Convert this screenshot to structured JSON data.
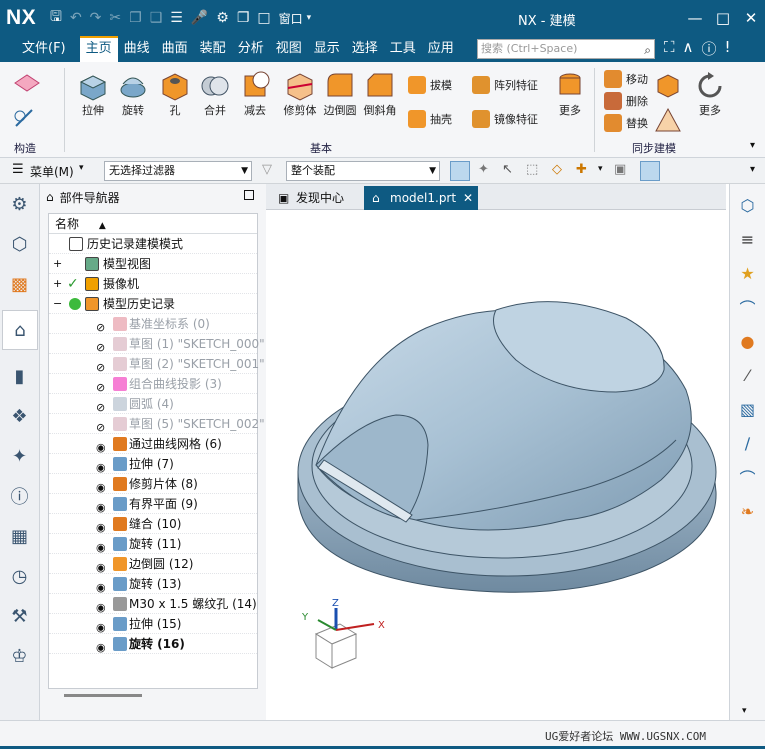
{
  "titlebar": {
    "logo": "NX",
    "window_menu": "窗口",
    "app_title": "NX - 建模",
    "minimize": "—",
    "restore": "□",
    "close": "✕"
  },
  "menubar": {
    "file": "文件(F)",
    "tabs": [
      "主页",
      "曲线",
      "曲面",
      "装配",
      "分析",
      "视图",
      "显示",
      "选择",
      "工具",
      "应用"
    ],
    "active_tab": "主页",
    "search_placeholder": "搜索 (Ctrl+Space)"
  },
  "ribbon": {
    "construct_label": "构造",
    "basic_group_label": "基本",
    "sync_group_label": "同步建模",
    "large_buttons": [
      "拉伸",
      "旋转",
      "孔",
      "合并",
      "减去",
      "修剪体",
      "边倒圆",
      "倒斜角"
    ],
    "small_buttons": [
      "拔模",
      "阵列特征",
      "抽壳",
      "镜像特征"
    ],
    "more_label": "更多",
    "sync_buttons": [
      "移动",
      "删除",
      "替换"
    ],
    "sync_more_label": "更多"
  },
  "filterbar": {
    "menu_label": "菜单(M)",
    "filter_value": "无选择过滤器",
    "assembly_value": "整个装配"
  },
  "navigator": {
    "title": "部件导航器",
    "column_name": "名称",
    "rows": [
      {
        "label": "历史记录建模模式",
        "state": "normal"
      },
      {
        "label": "模型视图",
        "state": "normal"
      },
      {
        "label": "摄像机",
        "state": "normal"
      },
      {
        "label": "模型历史记录",
        "state": "normal"
      },
      {
        "label": "基准坐标系 (0)",
        "state": "dim"
      },
      {
        "label": "草图 (1) \"SKETCH_000\"",
        "state": "dim"
      },
      {
        "label": "草图 (2) \"SKETCH_001\"",
        "state": "dim"
      },
      {
        "label": "组合曲线投影 (3)",
        "state": "dim"
      },
      {
        "label": "圆弧 (4)",
        "state": "dim"
      },
      {
        "label": "草图 (5) \"SKETCH_002\"",
        "state": "dim"
      },
      {
        "label": "通过曲线网格 (6)",
        "state": "normal"
      },
      {
        "label": "拉伸 (7)",
        "state": "normal"
      },
      {
        "label": "修剪片体 (8)",
        "state": "normal"
      },
      {
        "label": "有界平面 (9)",
        "state": "normal"
      },
      {
        "label": "缝合 (10)",
        "state": "normal"
      },
      {
        "label": "旋转 (11)",
        "state": "normal"
      },
      {
        "label": "边倒圆 (12)",
        "state": "normal"
      },
      {
        "label": "旋转 (13)",
        "state": "normal"
      },
      {
        "label": "M30 x 1.5 螺纹孔 (14)",
        "state": "normal"
      },
      {
        "label": "拉伸 (15)",
        "state": "normal"
      },
      {
        "label": "旋转 (16)",
        "state": "bold"
      }
    ]
  },
  "doctabs": {
    "tab1": "发现中心",
    "tab2": "model1.prt",
    "close": "✕"
  },
  "triad": {
    "x": "X",
    "y": "Y",
    "z": "Z"
  },
  "watermark": "UG爱好者论坛 WWW.UGSNX.COM",
  "colors": {
    "title_bg": "#0e5a82",
    "accent": "#f0a000",
    "model_fill": "#8fa9bd"
  }
}
